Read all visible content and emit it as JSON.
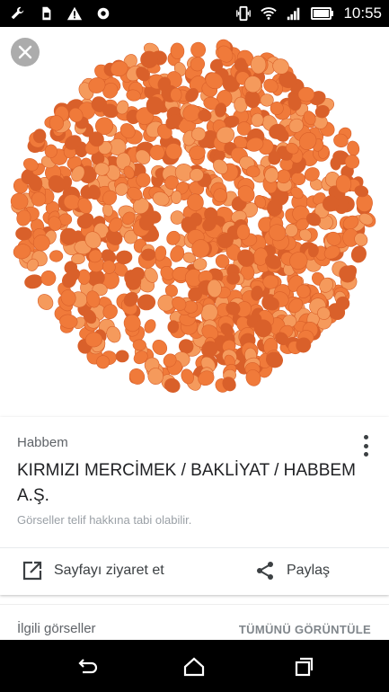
{
  "status_bar": {
    "time": "10:55",
    "left_icons": [
      "wrench-icon",
      "sim-icon",
      "warning-icon",
      "eye-icon"
    ],
    "right_icons": [
      "vibrate-icon",
      "wifi-icon",
      "signal-icon",
      "battery-icon"
    ]
  },
  "viewer": {
    "close_icon": "close-icon",
    "image_subject": "red lentils"
  },
  "result_card": {
    "source": "Habbem",
    "title": "KIRMIZI MERCİMEK / BAKLİYAT / HABBEM A.Ş.",
    "copyright_note": "Görseller telif hakkına tabi olabilir.",
    "visit_label": "Sayfayı ziyaret et",
    "share_label": "Paylaş"
  },
  "related": {
    "label": "İlgili görseller",
    "view_all": "TÜMÜNÜ GÖRÜNTÜLE"
  },
  "nav_bar": {
    "icons": [
      "back-icon",
      "home-icon",
      "recents-icon"
    ]
  },
  "colors": {
    "lentil": "#f07a3a",
    "lentil_dark": "#d9602a",
    "lentil_light": "#f59a5c"
  }
}
